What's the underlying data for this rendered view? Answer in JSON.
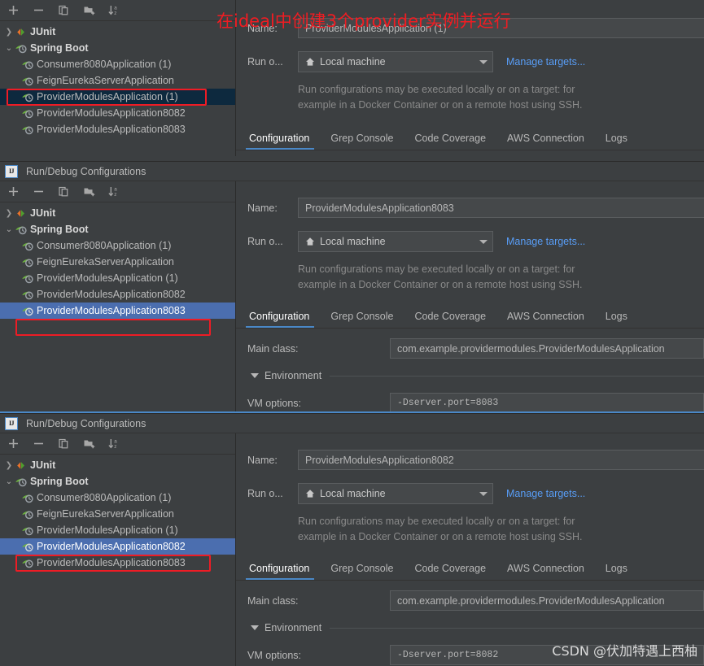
{
  "window": {
    "title": "Run/Debug Configurations",
    "app_icon": "IJ"
  },
  "toolbar": {
    "add_label": "+",
    "remove_label": "−",
    "copy_label": "copy-configuration",
    "folder_label": "new-folder",
    "sort_label": "sort-alphabetically",
    "sort_a": "a",
    "sort_z": "z"
  },
  "tree": {
    "junit_label": "JUnit",
    "spring_boot_label": "Spring Boot",
    "items": [
      "Consumer8080Application (1)",
      "FeignEurekaServerApplication",
      "ProviderModulesApplication (1)",
      "ProviderModulesApplication8082",
      "ProviderModulesApplication8083"
    ]
  },
  "form": {
    "name_label": "Name:",
    "run_on_label": "Run o...",
    "target_value": "Local machine",
    "manage_targets_label": "Manage targets...",
    "hint_line1": "Run configurations may be executed locally or on a target: for",
    "hint_line2": "example in a Docker Container or on a remote host using SSH.",
    "main_class_label": "Main class:",
    "main_class_value": "com.example.providermodules.ProviderModulesApplication",
    "environment_label": "Environment",
    "vm_options_label": "VM options:"
  },
  "tabs": [
    {
      "label": "Configuration",
      "active": true
    },
    {
      "label": "Grep Console",
      "active": false
    },
    {
      "label": "Code Coverage",
      "active": false
    },
    {
      "label": "AWS Connection",
      "active": false
    },
    {
      "label": "Logs",
      "active": false
    }
  ],
  "panels": [
    {
      "id": "panel-1",
      "name_value": "ProviderModulesApplication (1)",
      "selected_item": "ProviderModulesApplication (1)",
      "selected_index": 2,
      "selection_style": "inactive",
      "vm_options_value": ""
    },
    {
      "id": "panel-2",
      "name_value": "ProviderModulesApplication8083",
      "selected_item": "ProviderModulesApplication8083",
      "selected_index": 4,
      "selection_style": "active",
      "vm_options_value": "-Dserver.port=8083"
    },
    {
      "id": "panel-3",
      "name_value": "ProviderModulesApplication8082",
      "selected_item": "ProviderModulesApplication8082",
      "selected_index": 3,
      "selection_style": "active",
      "vm_options_value": "-Dserver.port=8082"
    }
  ],
  "annotations": {
    "chinese_note": "在ideal中创建3个provider实例并运行",
    "watermark": "CSDN @伏加特遇上西柚"
  },
  "colors": {
    "background": "#3c3f41",
    "selection_active": "#4b6eaf",
    "selection_inactive": "#0d293e",
    "accent_blue": "#4a88c7",
    "link_blue": "#589df6",
    "annotation_red": "#ee1c25",
    "spring_green": "#6db33f"
  }
}
